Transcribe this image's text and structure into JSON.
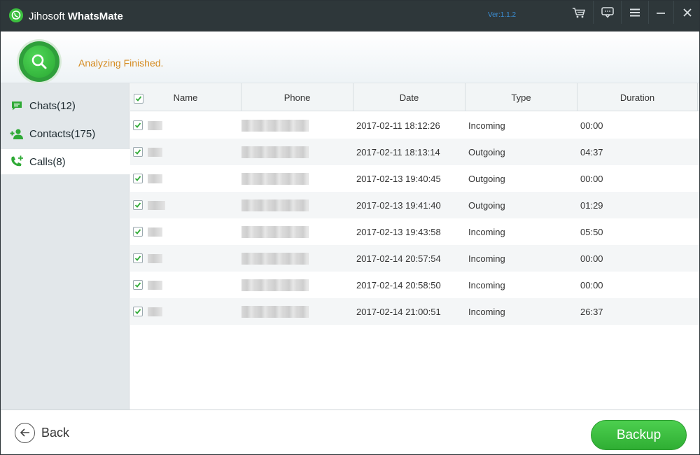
{
  "titlebar": {
    "brand": "Jihosoft",
    "app_name": "WhatsMate",
    "version": "Ver:1.1.2",
    "icons": [
      "cart-icon",
      "feedback-icon",
      "menu-icon",
      "minimize-icon",
      "close-icon"
    ]
  },
  "status": {
    "text": "Analyzing Finished.",
    "icon": "search-icon"
  },
  "sidebar": {
    "items": [
      {
        "label": "Chats(12)",
        "icon": "chat-icon",
        "active": false
      },
      {
        "label": "Contacts(175)",
        "icon": "add-contact-icon",
        "active": false
      },
      {
        "label": "Calls(8)",
        "icon": "call-icon",
        "active": true
      }
    ]
  },
  "table": {
    "columns": [
      "Name",
      "Phone",
      "Date",
      "Type",
      "Duration"
    ],
    "rows": [
      {
        "date": "2017-02-11 18:12:26",
        "type": "Incoming",
        "duration": "00:00"
      },
      {
        "date": "2017-02-11 18:13:14",
        "type": "Outgoing",
        "duration": "04:37"
      },
      {
        "date": "2017-02-13 19:40:45",
        "type": "Outgoing",
        "duration": "00:00"
      },
      {
        "date": "2017-02-13 19:41:40",
        "type": "Outgoing",
        "duration": "01:29"
      },
      {
        "date": "2017-02-13 19:43:58",
        "type": "Incoming",
        "duration": "05:50"
      },
      {
        "date": "2017-02-14 20:57:54",
        "type": "Incoming",
        "duration": "00:00"
      },
      {
        "date": "2017-02-14 20:58:50",
        "type": "Incoming",
        "duration": "00:00"
      },
      {
        "date": "2017-02-14 21:00:51",
        "type": "Incoming",
        "duration": "26:37"
      }
    ]
  },
  "footer": {
    "back_label": "Back",
    "backup_label": "Backup"
  },
  "colors": {
    "accent_green": "#3cbf3f",
    "titlebar": "#2e373a",
    "status_text": "#d58a1f",
    "version_text": "#3b8fd6"
  }
}
